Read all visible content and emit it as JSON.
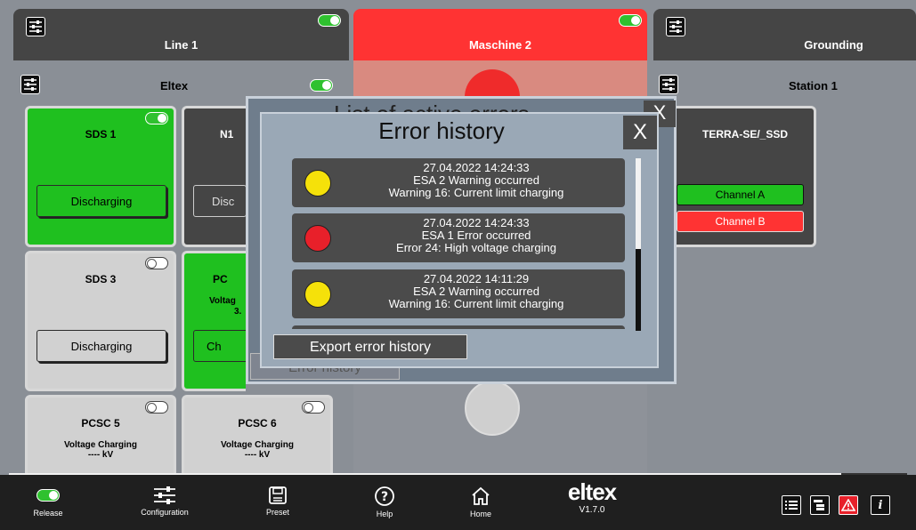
{
  "columns": {
    "line1": {
      "title": "Line 1"
    },
    "maschine2": {
      "title": "Maschine 2"
    },
    "grounding": {
      "title": "Grounding"
    }
  },
  "subheaders": {
    "eltex": "Eltex",
    "station1": "Station 1"
  },
  "cards": {
    "sds1": {
      "title": "SDS 1",
      "button": "Discharging"
    },
    "n1": {
      "title": "N1",
      "button": "Disc"
    },
    "sds3": {
      "title": "SDS 3",
      "button": "Discharging"
    },
    "pc": {
      "title": "PC",
      "sub1": "Voltag",
      "sub2": "3.",
      "button": "Ch"
    },
    "pcsc5": {
      "title": "PCSC 5",
      "sub1": "Voltage Charging",
      "sub2": "---- kV"
    },
    "pcsc6": {
      "title": "PCSC 6",
      "sub1": "Voltage Charging",
      "sub2": "---- kV"
    },
    "terra": {
      "title": "TERRA-SE/_SSD",
      "channel_a": "Channel A",
      "channel_b": "Channel B"
    }
  },
  "background_dialog": {
    "title": "List of active errors",
    "close": "X",
    "button": "Error history"
  },
  "dialog": {
    "title": "Error history",
    "close": "X",
    "errors": [
      {
        "timestamp": "27.04.2022 14:24:33",
        "event": "ESA 2 Warning occurred",
        "detail": "Warning 16: Current limit charging",
        "level": "yellow"
      },
      {
        "timestamp": "27.04.2022 14:24:33",
        "event": "ESA 1 Error occurred",
        "detail": "Error 24: High voltage charging",
        "level": "red"
      },
      {
        "timestamp": "27.04.2022 14:11:29",
        "event": "ESA 2 Warning occurred",
        "detail": "Warning 16: Current limit charging",
        "level": "yellow"
      }
    ],
    "export_button": "Export error history"
  },
  "footer": {
    "release": "Release",
    "configuration": "Configuration",
    "preset": "Preset",
    "help": "Help",
    "home": "Home",
    "logo": "eltex",
    "version": "V1.7.0"
  },
  "colors": {
    "green": "#1fc01f",
    "red": "#ff3333",
    "dark": "#454545",
    "yellow": "#f5e10a",
    "error_red": "#e8202a"
  }
}
